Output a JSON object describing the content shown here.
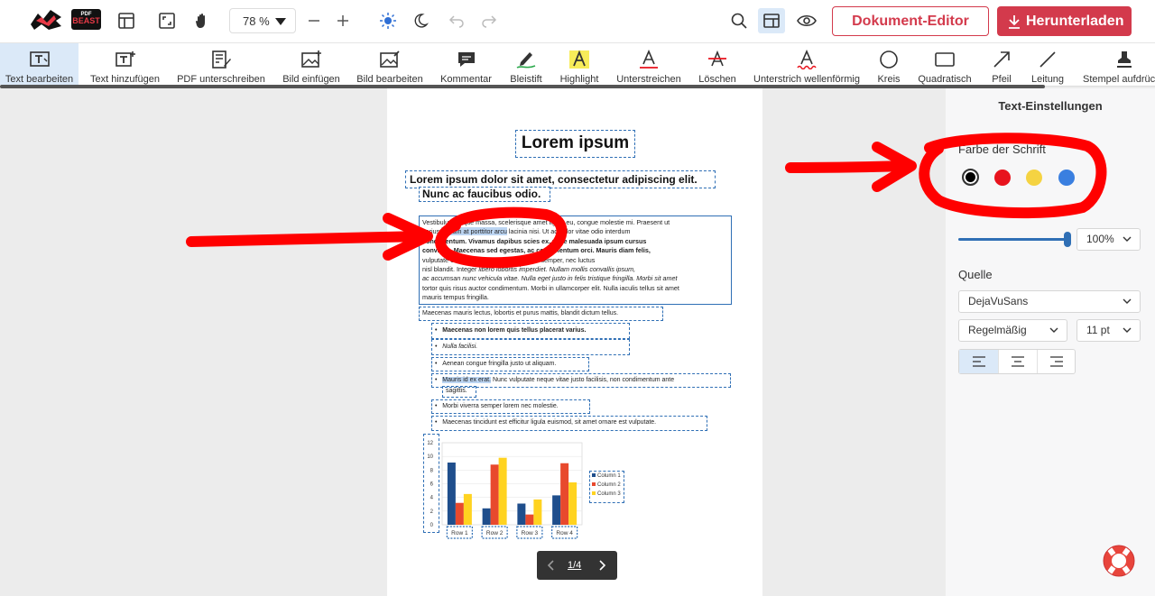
{
  "brand": {
    "line1": "PDF",
    "line2": "BEAST"
  },
  "topbar": {
    "zoom_value": "78 %",
    "editor_button": "Dokument-Editor",
    "download_button": "Herunterladen"
  },
  "tools": [
    {
      "label": "Text bearbeiten",
      "icon": "text-edit-icon",
      "active": true
    },
    {
      "label": "Text hinzufügen",
      "icon": "text-add-icon"
    },
    {
      "label": "PDF unterschreiben",
      "icon": "sign-icon"
    },
    {
      "label": "Bild einfügen",
      "icon": "image-add-icon"
    },
    {
      "label": "Bild bearbeiten",
      "icon": "image-edit-icon"
    },
    {
      "label": "Kommentar",
      "icon": "comment-icon"
    },
    {
      "label": "Bleistift",
      "icon": "pencil-icon"
    },
    {
      "label": "Highlight",
      "icon": "highlight-icon"
    },
    {
      "label": "Unterstreichen",
      "icon": "underline-icon"
    },
    {
      "label": "Löschen",
      "icon": "strikethrough-icon"
    },
    {
      "label": "Unterstrich wellenförmig",
      "icon": "wavy-underline-icon"
    },
    {
      "label": "Kreis",
      "icon": "circle-icon"
    },
    {
      "label": "Quadratisch",
      "icon": "square-icon"
    },
    {
      "label": "Pfeil",
      "icon": "arrow-icon"
    },
    {
      "label": "Leitung",
      "icon": "line-icon"
    },
    {
      "label": "Stempel aufdrücl",
      "icon": "stamp-icon"
    }
  ],
  "document": {
    "title": "Lorem ipsum",
    "subtitle1": "Lorem ipsum dolor sit amet, consectetur adipiscing elit.",
    "subtitle2": "Nunc ac faucibus odio.",
    "para_lines": [
      [
        "Vestibulum ",
        "neque massa, scelerisque ",
        "amet ligula eu, congue molestie mi. Praesent ut"
      ],
      [
        "varius ",
        "Nullam at porttitor arcu",
        " lacinia nisi. Ut ac dolor vitae odio interdum"
      ],
      [
        "condimentum. Vivamus dapibus sc",
        "ies ex, vitae malesuada ipsum cursus"
      ],
      [
        "convallis. Maecenas sed egestas",
        ", ac condimentum orci. Mauris diam felis,"
      ],
      [
        "vulputate ",
        "curabitur semper arcu ac ligula semper, nec luctus"
      ],
      [
        "nisl blandit. Integer ",
        "libero lobortis imperdiet. Nullam mollis convallis ipsum,"
      ],
      [
        "ac accumsan nunc vehicula vitae. Nulla eget justo in felis tristique fringilla. Morbi sit amet"
      ],
      [
        "tortor quis risus auctor condimentum. Morbi in ullamcorper elit. Nulla iaculis tellus sit amet"
      ],
      [
        "mauris tempus fringilla."
      ]
    ],
    "line_after": "Maecenas mauris lectus, lobortis et purus mattis, blandit dictum tellus.",
    "bullets": [
      "Maecenas non lorem quis tellus placerat varius.",
      "Nulla facilisi.",
      "Aenean congue fringilla justo ut aliquam.",
      "Nunc vulputate neque vitae justo facilisis, non condimentum ante",
      "Morbi viverra semper lorem nec molestie.",
      "Maecenas tincidunt est efficitur ligula euismod, sit amet ornare est vulputate."
    ],
    "bullet4_highlight": "Mauris id ex erat.",
    "bullet4_wrap": "sagittis."
  },
  "chart_data": {
    "type": "bar",
    "categories": [
      "Row 1",
      "Row 2",
      "Row 3",
      "Row 4"
    ],
    "series": [
      {
        "name": "Column 1",
        "values": [
          9.1,
          2.4,
          3.1,
          4.3
        ],
        "color": "#1f4e8c"
      },
      {
        "name": "Column 2",
        "values": [
          3.2,
          8.8,
          1.5,
          9.0
        ],
        "color": "#e8492d"
      },
      {
        "name": "Column 3",
        "values": [
          4.5,
          9.8,
          3.7,
          6.2
        ],
        "color": "#ffd320"
      }
    ],
    "y_ticks": [
      "0",
      "2",
      "4",
      "6",
      "8",
      "10",
      "12"
    ],
    "ylim": [
      0,
      12
    ],
    "legend_position": "right"
  },
  "pager": {
    "text": "1/4"
  },
  "panel": {
    "title": "Text-Einstellungen",
    "font_color_label": "Farbe der Schrift",
    "colors": [
      "#000000",
      "#e8131d",
      "#f5d342",
      "#3a7fe0"
    ],
    "opacity_value": "100%",
    "font_label": "Quelle",
    "font_family_value": "DejaVuSans",
    "font_style_value": "Regelmäßig",
    "font_size_value": "11 pt"
  },
  "annotation_color": "#ff0000"
}
